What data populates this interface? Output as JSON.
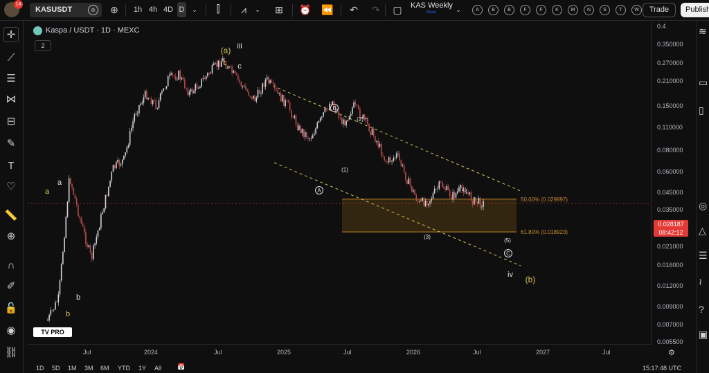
{
  "topbar": {
    "notification_count": "14",
    "symbol": "KASUSDT",
    "intervals": [
      "1h",
      "4h",
      "4D",
      "D"
    ],
    "selected_interval": "D",
    "layout_name": "KAS Weekly",
    "layout_status": "Save",
    "watchlist_letters": [
      "A",
      "B",
      "B",
      "F",
      "F",
      "K",
      "M",
      "N",
      "S",
      "T",
      "W"
    ],
    "trade_label": "Trade",
    "publish_label": "Publish"
  },
  "legend": {
    "title": "Kaspa / USDT · 1D · MEXC",
    "indicator_count": "2"
  },
  "price_axis": {
    "labels": [
      "0.4",
      "0.350000",
      "0.270000",
      "0.210000",
      "0.150000",
      "0.110000",
      "0.080000",
      "0.060000",
      "0.045000",
      "0.035000",
      "0.021000",
      "0.016000",
      "0.012000",
      "0.009000",
      "0.007000",
      "0.005500"
    ],
    "current_price": "0.028187",
    "countdown": "08:42:12"
  },
  "time_axis": {
    "labels": [
      "Jul",
      "2024",
      "Jul",
      "2025",
      "Jul",
      "2026",
      "Jul",
      "2027",
      "Jul"
    ]
  },
  "bottombar": {
    "ranges": [
      "1D",
      "5D",
      "1M",
      "3M",
      "6M",
      "YTD",
      "1Y",
      "All"
    ],
    "clock": "15:17:48 UTC"
  },
  "annotations": {
    "wave_a_yellow": "a",
    "wave_a_white": "a",
    "wave_b_white": "b",
    "wave_b_yellow": "b",
    "wave_a_paren": "(a)",
    "wave_c_yellow": "c",
    "wave_iii": "iii",
    "wave_c_white": "c",
    "wave_A": "A",
    "wave_B": "B",
    "wave_C": "C",
    "wave_1": "(1)",
    "wave_2": "(2)",
    "wave_3": "(3)",
    "wave_4": "(4)",
    "wave_5": "(5)",
    "wave_iv": "iv",
    "wave_b_paren": "(b)",
    "fib_50": "50.00% (0.029897)",
    "fib_618": "61.80% (0.018923)"
  },
  "colors": {
    "background": "#0f0f0f",
    "up_candle": "#d1d4dc",
    "down_candle": "#b84a4a",
    "fib_zone": "#3a2a10",
    "fib_line": "#c8892a",
    "channel": "#d9c55a",
    "current_price": "#e53935",
    "yellow_label": "#d9c55a"
  },
  "chart_data": {
    "type": "line",
    "title": "Kaspa / USDT · 1D · MEXC",
    "x_labels": [
      "Jul",
      "2024",
      "Jul",
      "2025",
      "Jul",
      "2026",
      "Jul",
      "2027",
      "Jul"
    ],
    "price_trace": [
      {
        "t": "2023-03",
        "p": 0.0055
      },
      {
        "t": "2023-04",
        "p": 0.0075
      },
      {
        "t": "2023-05",
        "p": 0.041
      },
      {
        "t": "2023-06",
        "p": 0.022
      },
      {
        "t": "2023-07",
        "p": 0.013
      },
      {
        "t": "2023-08",
        "p": 0.025
      },
      {
        "t": "2023-09",
        "p": 0.046
      },
      {
        "t": "2023-10",
        "p": 0.052
      },
      {
        "t": "2023-11",
        "p": 0.1
      },
      {
        "t": "2023-12",
        "p": 0.13
      },
      {
        "t": "2024-01",
        "p": 0.11
      },
      {
        "t": "2024-02",
        "p": 0.16
      },
      {
        "t": "2024-03",
        "p": 0.17
      },
      {
        "t": "2024-04",
        "p": 0.13
      },
      {
        "t": "2024-06",
        "p": 0.18
      },
      {
        "t": "2024-07",
        "p": 0.21
      },
      {
        "t": "2024-08",
        "p": 0.17
      },
      {
        "t": "2024-09",
        "p": 0.14
      },
      {
        "t": "2024-10",
        "p": 0.12
      },
      {
        "t": "2024-11",
        "p": 0.16
      },
      {
        "t": "2024-12",
        "p": 0.13
      },
      {
        "t": "2025-01",
        "p": 0.11
      },
      {
        "t": "2025-02",
        "p": 0.08
      },
      {
        "t": "2025-03",
        "p": 0.07
      },
      {
        "t": "2025-04",
        "p": 0.09
      },
      {
        "t": "2025-05",
        "p": 0.12
      },
      {
        "t": "2025-06",
        "p": 0.085
      },
      {
        "t": "2025-07",
        "p": 0.11
      },
      {
        "t": "2025-08",
        "p": 0.09
      },
      {
        "t": "2025-09",
        "p": 0.07
      },
      {
        "t": "2025-10",
        "p": 0.05
      },
      {
        "t": "2025-11",
        "p": 0.055
      },
      {
        "t": "2025-12",
        "p": 0.038
      },
      {
        "t": "2026-01",
        "p": 0.028
      },
      {
        "t": "2026-02",
        "p": 0.03
      },
      {
        "t": "2026-03",
        "p": 0.037
      },
      {
        "t": "2026-04",
        "p": 0.031
      },
      {
        "t": "2026-05",
        "p": 0.035
      },
      {
        "t": "2026-06",
        "p": 0.029
      },
      {
        "t": "2026-07",
        "p": 0.028187
      }
    ],
    "fib_levels": [
      {
        "label": "50.00%",
        "price": 0.029897
      },
      {
        "label": "61.80%",
        "price": 0.018923
      }
    ],
    "ylim": [
      0.0055,
      0.4
    ],
    "yscale": "log"
  }
}
